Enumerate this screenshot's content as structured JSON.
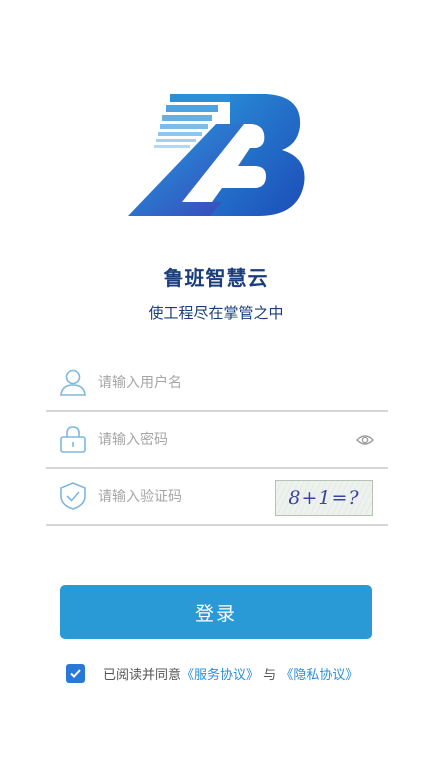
{
  "app": {
    "name": "鲁班智慧云",
    "slogan": "使工程尽在掌管之中"
  },
  "form": {
    "username": {
      "placeholder": "请输入用户名",
      "value": "",
      "icon": "user-icon"
    },
    "password": {
      "placeholder": "请输入密码",
      "value": "",
      "icon": "lock-icon",
      "toggle_icon": "eye-icon"
    },
    "captcha": {
      "placeholder": "请输入验证码",
      "value": "",
      "icon": "shield-check-icon",
      "image_text": "8+1=?"
    }
  },
  "login_button": {
    "label": "登录"
  },
  "agreement": {
    "checked": true,
    "prefix": "已阅读并同意",
    "service_link": "《服务协议》",
    "conjunction": "与",
    "privacy_link": "《隐私协议》"
  },
  "colors": {
    "primary": "#2a9ad6",
    "title": "#1a3d7c",
    "link": "#2a8fd8",
    "checkbox": "#2878d8",
    "icon": "#7fb7df",
    "divider": "#d6d6d6"
  }
}
